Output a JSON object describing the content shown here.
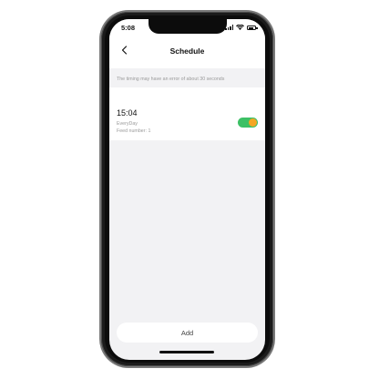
{
  "status_bar": {
    "time": "5:08",
    "icons": [
      "signal-icon",
      "wifi-icon",
      "battery-icon"
    ]
  },
  "nav": {
    "title": "Schedule",
    "back_icon": "chevron-left-icon"
  },
  "notice": "The timing may have an error of about 30 seconds",
  "schedules": [
    {
      "time": "15:04",
      "repeat": "EveryDay",
      "feed": "Feed number: 1",
      "enabled": true
    }
  ],
  "add_label": "Add",
  "colors": {
    "toggle_on": "#3cc065",
    "toggle_knob": "#f5a623",
    "background": "#f2f2f4"
  }
}
